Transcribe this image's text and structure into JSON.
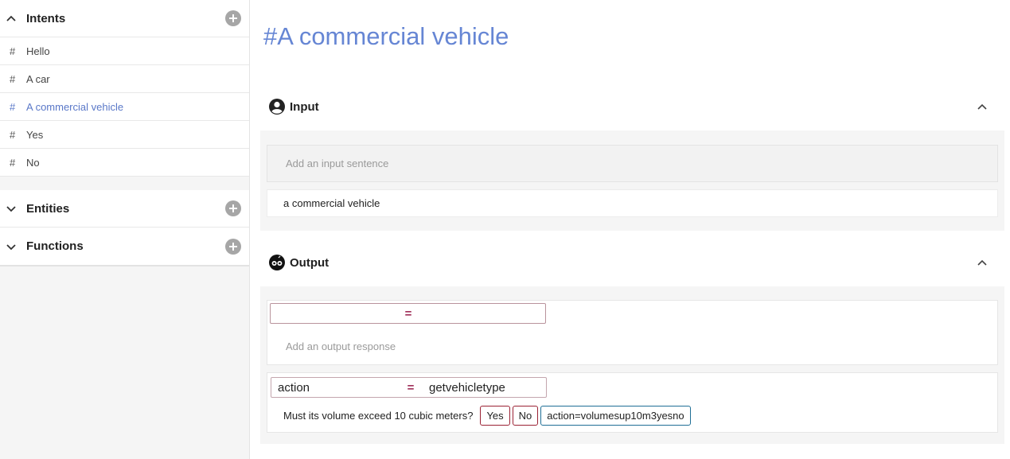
{
  "sidebar": {
    "intents": {
      "title": "Intents",
      "items": [
        {
          "label": "Hello"
        },
        {
          "label": "A car"
        },
        {
          "label": "A commercial vehicle",
          "active": true
        },
        {
          "label": "Yes"
        },
        {
          "label": "No"
        }
      ],
      "hash": "#"
    },
    "entities": {
      "title": "Entities"
    },
    "functions": {
      "title": "Functions"
    }
  },
  "main": {
    "title": "#A commercial vehicle",
    "input": {
      "title": "Input",
      "placeholder": "Add an input sentence",
      "sentences": [
        "a commercial vehicle"
      ]
    },
    "output": {
      "title": "Output",
      "blank_eq": "=",
      "placeholder": "Add an output response",
      "responses": [
        {
          "key": "action",
          "eq": "=",
          "value": "getvehicletype",
          "text": "Must its volume exceed 10 cubic meters?",
          "chips": [
            {
              "label": "Yes",
              "style": "red"
            },
            {
              "label": "No",
              "style": "red"
            },
            {
              "label": "action=volumesup10m3yesno",
              "style": "blue"
            }
          ]
        }
      ]
    }
  },
  "colors": {
    "accent": "#6686d4",
    "active_item": "#5a78c8",
    "equals": "#a0305a",
    "chip_red": "#9b2234",
    "chip_blue": "#1f6f96"
  }
}
